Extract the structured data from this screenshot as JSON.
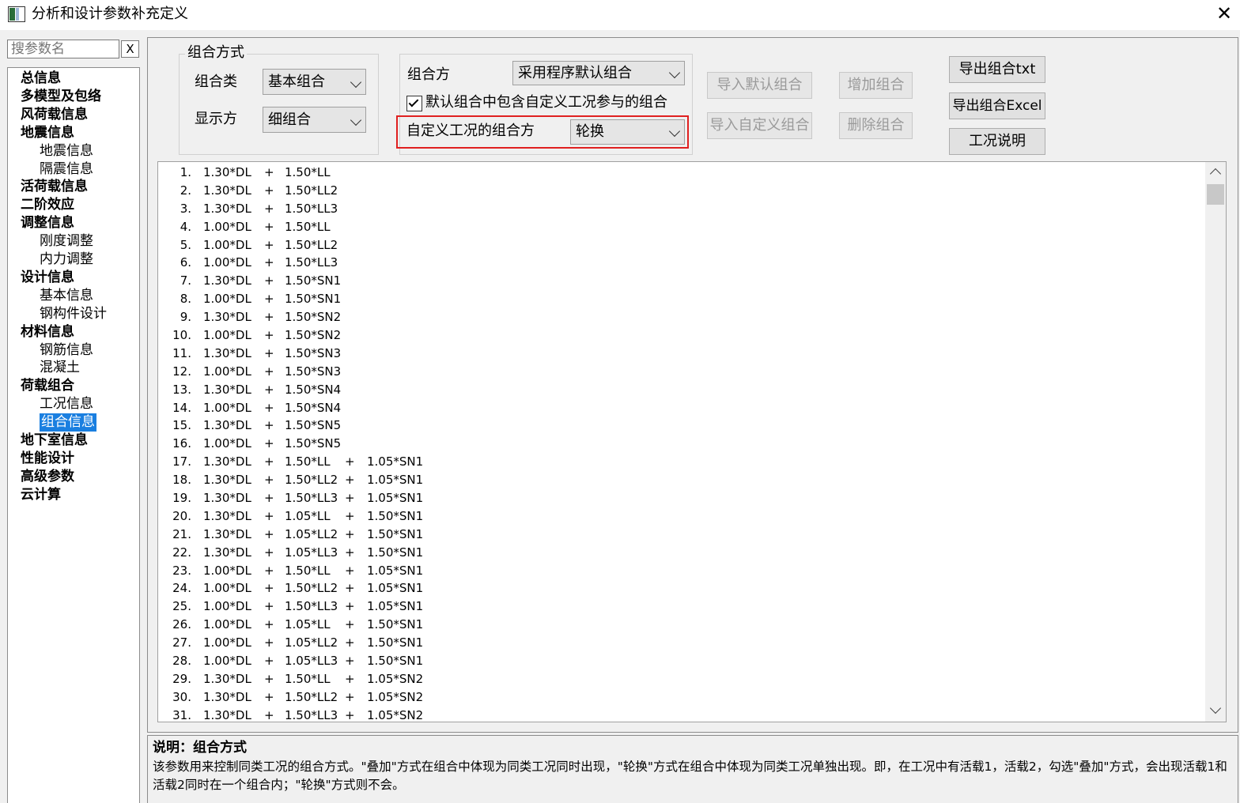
{
  "window": {
    "title": "分析和设计参数补充定义",
    "close": "✕"
  },
  "search": {
    "placeholder": "搜参数名",
    "clear": "X"
  },
  "tree": [
    {
      "label": "总信息",
      "level": 0
    },
    {
      "label": "多模型及包络",
      "level": 0
    },
    {
      "label": "风荷载信息",
      "level": 0
    },
    {
      "label": "地震信息",
      "level": 0
    },
    {
      "label": "地震信息",
      "level": 1
    },
    {
      "label": "隔震信息",
      "level": 1
    },
    {
      "label": "活荷载信息",
      "level": 0
    },
    {
      "label": "二阶效应",
      "level": 0
    },
    {
      "label": "调整信息",
      "level": 0
    },
    {
      "label": "刚度调整",
      "level": 1
    },
    {
      "label": "内力调整",
      "level": 1
    },
    {
      "label": "设计信息",
      "level": 0
    },
    {
      "label": "基本信息",
      "level": 1
    },
    {
      "label": "钢构件设计",
      "level": 1
    },
    {
      "label": "材料信息",
      "level": 0
    },
    {
      "label": "钢筋信息",
      "level": 1
    },
    {
      "label": "混凝土",
      "level": 1
    },
    {
      "label": "荷载组合",
      "level": 0
    },
    {
      "label": "工况信息",
      "level": 1
    },
    {
      "label": "组合信息",
      "level": 1,
      "selected": true
    },
    {
      "label": "地下室信息",
      "level": 0
    },
    {
      "label": "性能设计",
      "level": 0
    },
    {
      "label": "高级参数",
      "level": 0
    },
    {
      "label": "云计算",
      "level": 0
    }
  ],
  "combo_method": {
    "group_title": "组合方式",
    "type_label": "组合类",
    "type_value": "基本组合",
    "display_label": "显示方",
    "display_value": "细组合"
  },
  "combo_settings": {
    "method_label": "组合方",
    "method_value": "采用程序默认组合",
    "include_custom_checked": true,
    "include_custom_label": "默认组合中包含自定义工况参与的组合",
    "custom_method_label": "自定义工况的组合方",
    "custom_method_value": "轮换"
  },
  "buttons": {
    "import_default": "导入默认组合",
    "add_combo": "增加组合",
    "import_custom": "导入自定义组合",
    "delete_combo": "删除组合",
    "export_txt": "导出组合txt",
    "export_excel": "导出组合Excel",
    "case_desc": "工况说明"
  },
  "combinations": [
    [
      "1.",
      "1.30*DL",
      "+",
      "1.50*LL"
    ],
    [
      "2.",
      "1.30*DL",
      "+",
      "1.50*LL2"
    ],
    [
      "3.",
      "1.30*DL",
      "+",
      "1.50*LL3"
    ],
    [
      "4.",
      "1.00*DL",
      "+",
      "1.50*LL"
    ],
    [
      "5.",
      "1.00*DL",
      "+",
      "1.50*LL2"
    ],
    [
      "6.",
      "1.00*DL",
      "+",
      "1.50*LL3"
    ],
    [
      "7.",
      "1.30*DL",
      "+",
      "1.50*SN1"
    ],
    [
      "8.",
      "1.00*DL",
      "+",
      "1.50*SN1"
    ],
    [
      "9.",
      "1.30*DL",
      "+",
      "1.50*SN2"
    ],
    [
      "10.",
      "1.00*DL",
      "+",
      "1.50*SN2"
    ],
    [
      "11.",
      "1.30*DL",
      "+",
      "1.50*SN3"
    ],
    [
      "12.",
      "1.00*DL",
      "+",
      "1.50*SN3"
    ],
    [
      "13.",
      "1.30*DL",
      "+",
      "1.50*SN4"
    ],
    [
      "14.",
      "1.00*DL",
      "+",
      "1.50*SN4"
    ],
    [
      "15.",
      "1.30*DL",
      "+",
      "1.50*SN5"
    ],
    [
      "16.",
      "1.00*DL",
      "+",
      "1.50*SN5"
    ],
    [
      "17.",
      "1.30*DL",
      "+",
      "1.50*LL",
      "+",
      "1.05*SN1"
    ],
    [
      "18.",
      "1.30*DL",
      "+",
      "1.50*LL2",
      "+",
      "1.05*SN1"
    ],
    [
      "19.",
      "1.30*DL",
      "+",
      "1.50*LL3",
      "+",
      "1.05*SN1"
    ],
    [
      "20.",
      "1.30*DL",
      "+",
      "1.05*LL",
      "+",
      "1.50*SN1"
    ],
    [
      "21.",
      "1.30*DL",
      "+",
      "1.05*LL2",
      "+",
      "1.50*SN1"
    ],
    [
      "22.",
      "1.30*DL",
      "+",
      "1.05*LL3",
      "+",
      "1.50*SN1"
    ],
    [
      "23.",
      "1.00*DL",
      "+",
      "1.50*LL",
      "+",
      "1.05*SN1"
    ],
    [
      "24.",
      "1.00*DL",
      "+",
      "1.50*LL2",
      "+",
      "1.05*SN1"
    ],
    [
      "25.",
      "1.00*DL",
      "+",
      "1.50*LL3",
      "+",
      "1.05*SN1"
    ],
    [
      "26.",
      "1.00*DL",
      "+",
      "1.05*LL",
      "+",
      "1.50*SN1"
    ],
    [
      "27.",
      "1.00*DL",
      "+",
      "1.05*LL2",
      "+",
      "1.50*SN1"
    ],
    [
      "28.",
      "1.00*DL",
      "+",
      "1.05*LL3",
      "+",
      "1.50*SN1"
    ],
    [
      "29.",
      "1.30*DL",
      "+",
      "1.50*LL",
      "+",
      "1.05*SN2"
    ],
    [
      "30.",
      "1.30*DL",
      "+",
      "1.50*LL2",
      "+",
      "1.05*SN2"
    ],
    [
      "31.",
      "1.30*DL",
      "+",
      "1.50*LL3",
      "+",
      "1.05*SN2"
    ]
  ],
  "description": {
    "title": "说明：组合方式",
    "body": "该参数用来控制同类工况的组合方式。\"叠加\"方式在组合中体现为同类工况同时出现，\"轮换\"方式在组合中体现为同类工况单独出现。即，在工况中有活载1，活载2，勾选\"叠加\"方式，会出现活载1和活载2同时在一个组合内；\"轮换\"方式则不会。"
  },
  "colors": {
    "highlight_border": "#e02020",
    "selection": "#1a7fe0",
    "search_text": "#1a3ed1"
  }
}
